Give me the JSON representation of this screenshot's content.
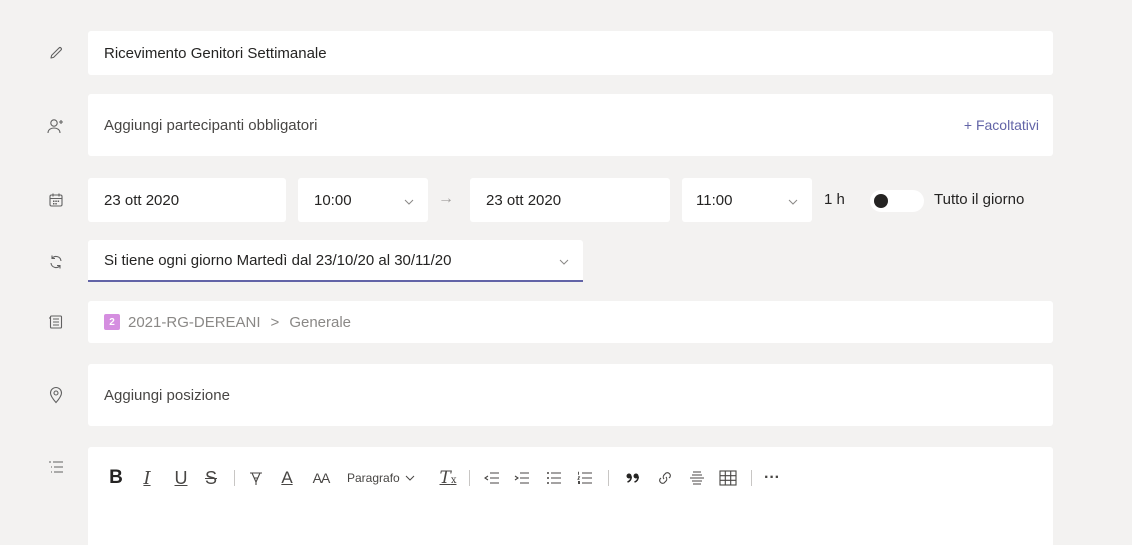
{
  "title": {
    "value": "Ricevimento Genitori Settimanale"
  },
  "attendees": {
    "placeholder": "Aggiungi partecipanti obbligatori",
    "optional_label": "+ Facoltativi"
  },
  "datetime": {
    "start_date": "23 ott 2020",
    "start_time": "10:00",
    "arrow": "→",
    "end_date": "23 ott 2020",
    "end_time": "11:00",
    "duration": "1 h",
    "all_day_label": "Tutto il giorno"
  },
  "recurrence": {
    "value": "Si tiene ogni giorno Martedì dal 23/10/20 al 30/11/20",
    "accent_color": "#6264a7"
  },
  "channel": {
    "badge": "2",
    "team": "2021-RG-DEREANI",
    "separator": ">",
    "channel": "Generale",
    "badge_color": "#d58ee0"
  },
  "location": {
    "placeholder": "Aggiungi posizione"
  },
  "editor": {
    "toolbar": {
      "bold": "B",
      "italic": "I",
      "underline": "U",
      "strike": "S",
      "font_color": "A",
      "font_size": "AA",
      "paragraph": "Paragrafo",
      "clear_format": "T",
      "clear_format_sub": "x",
      "more": "···"
    }
  }
}
